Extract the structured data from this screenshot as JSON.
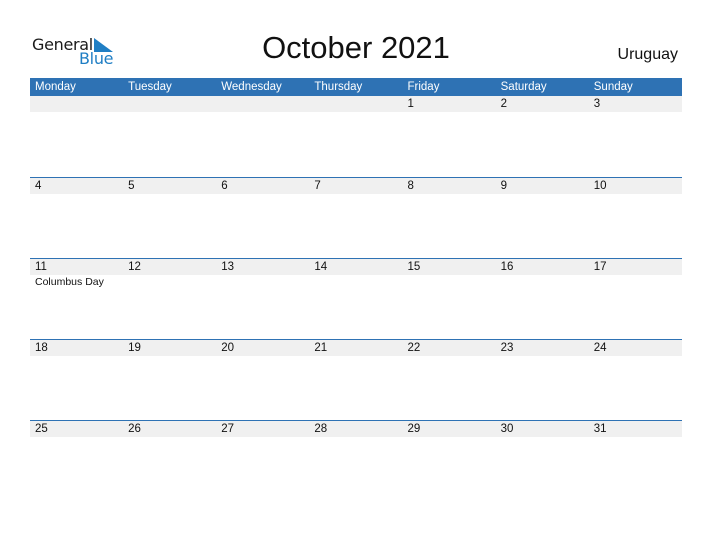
{
  "logo": {
    "word1": "General",
    "word2": "Blue"
  },
  "title": "October 2021",
  "country": "Uruguay",
  "colors": {
    "accent": "#2e72b4",
    "band": "#f0f0f0",
    "logo_blue": "#1f7ec4"
  },
  "weekdays": [
    "Monday",
    "Tuesday",
    "Wednesday",
    "Thursday",
    "Friday",
    "Saturday",
    "Sunday"
  ],
  "weeks": [
    {
      "days": [
        "",
        "",
        "",
        "",
        "1",
        "2",
        "3"
      ],
      "events": [
        "",
        "",
        "",
        "",
        "",
        "",
        ""
      ]
    },
    {
      "days": [
        "4",
        "5",
        "6",
        "7",
        "8",
        "9",
        "10"
      ],
      "events": [
        "",
        "",
        "",
        "",
        "",
        "",
        ""
      ]
    },
    {
      "days": [
        "11",
        "12",
        "13",
        "14",
        "15",
        "16",
        "17"
      ],
      "events": [
        "Columbus Day",
        "",
        "",
        "",
        "",
        "",
        ""
      ]
    },
    {
      "days": [
        "18",
        "19",
        "20",
        "21",
        "22",
        "23",
        "24"
      ],
      "events": [
        "",
        "",
        "",
        "",
        "",
        "",
        ""
      ]
    },
    {
      "days": [
        "25",
        "26",
        "27",
        "28",
        "29",
        "30",
        "31"
      ],
      "events": [
        "",
        "",
        "",
        "",
        "",
        "",
        ""
      ]
    }
  ]
}
